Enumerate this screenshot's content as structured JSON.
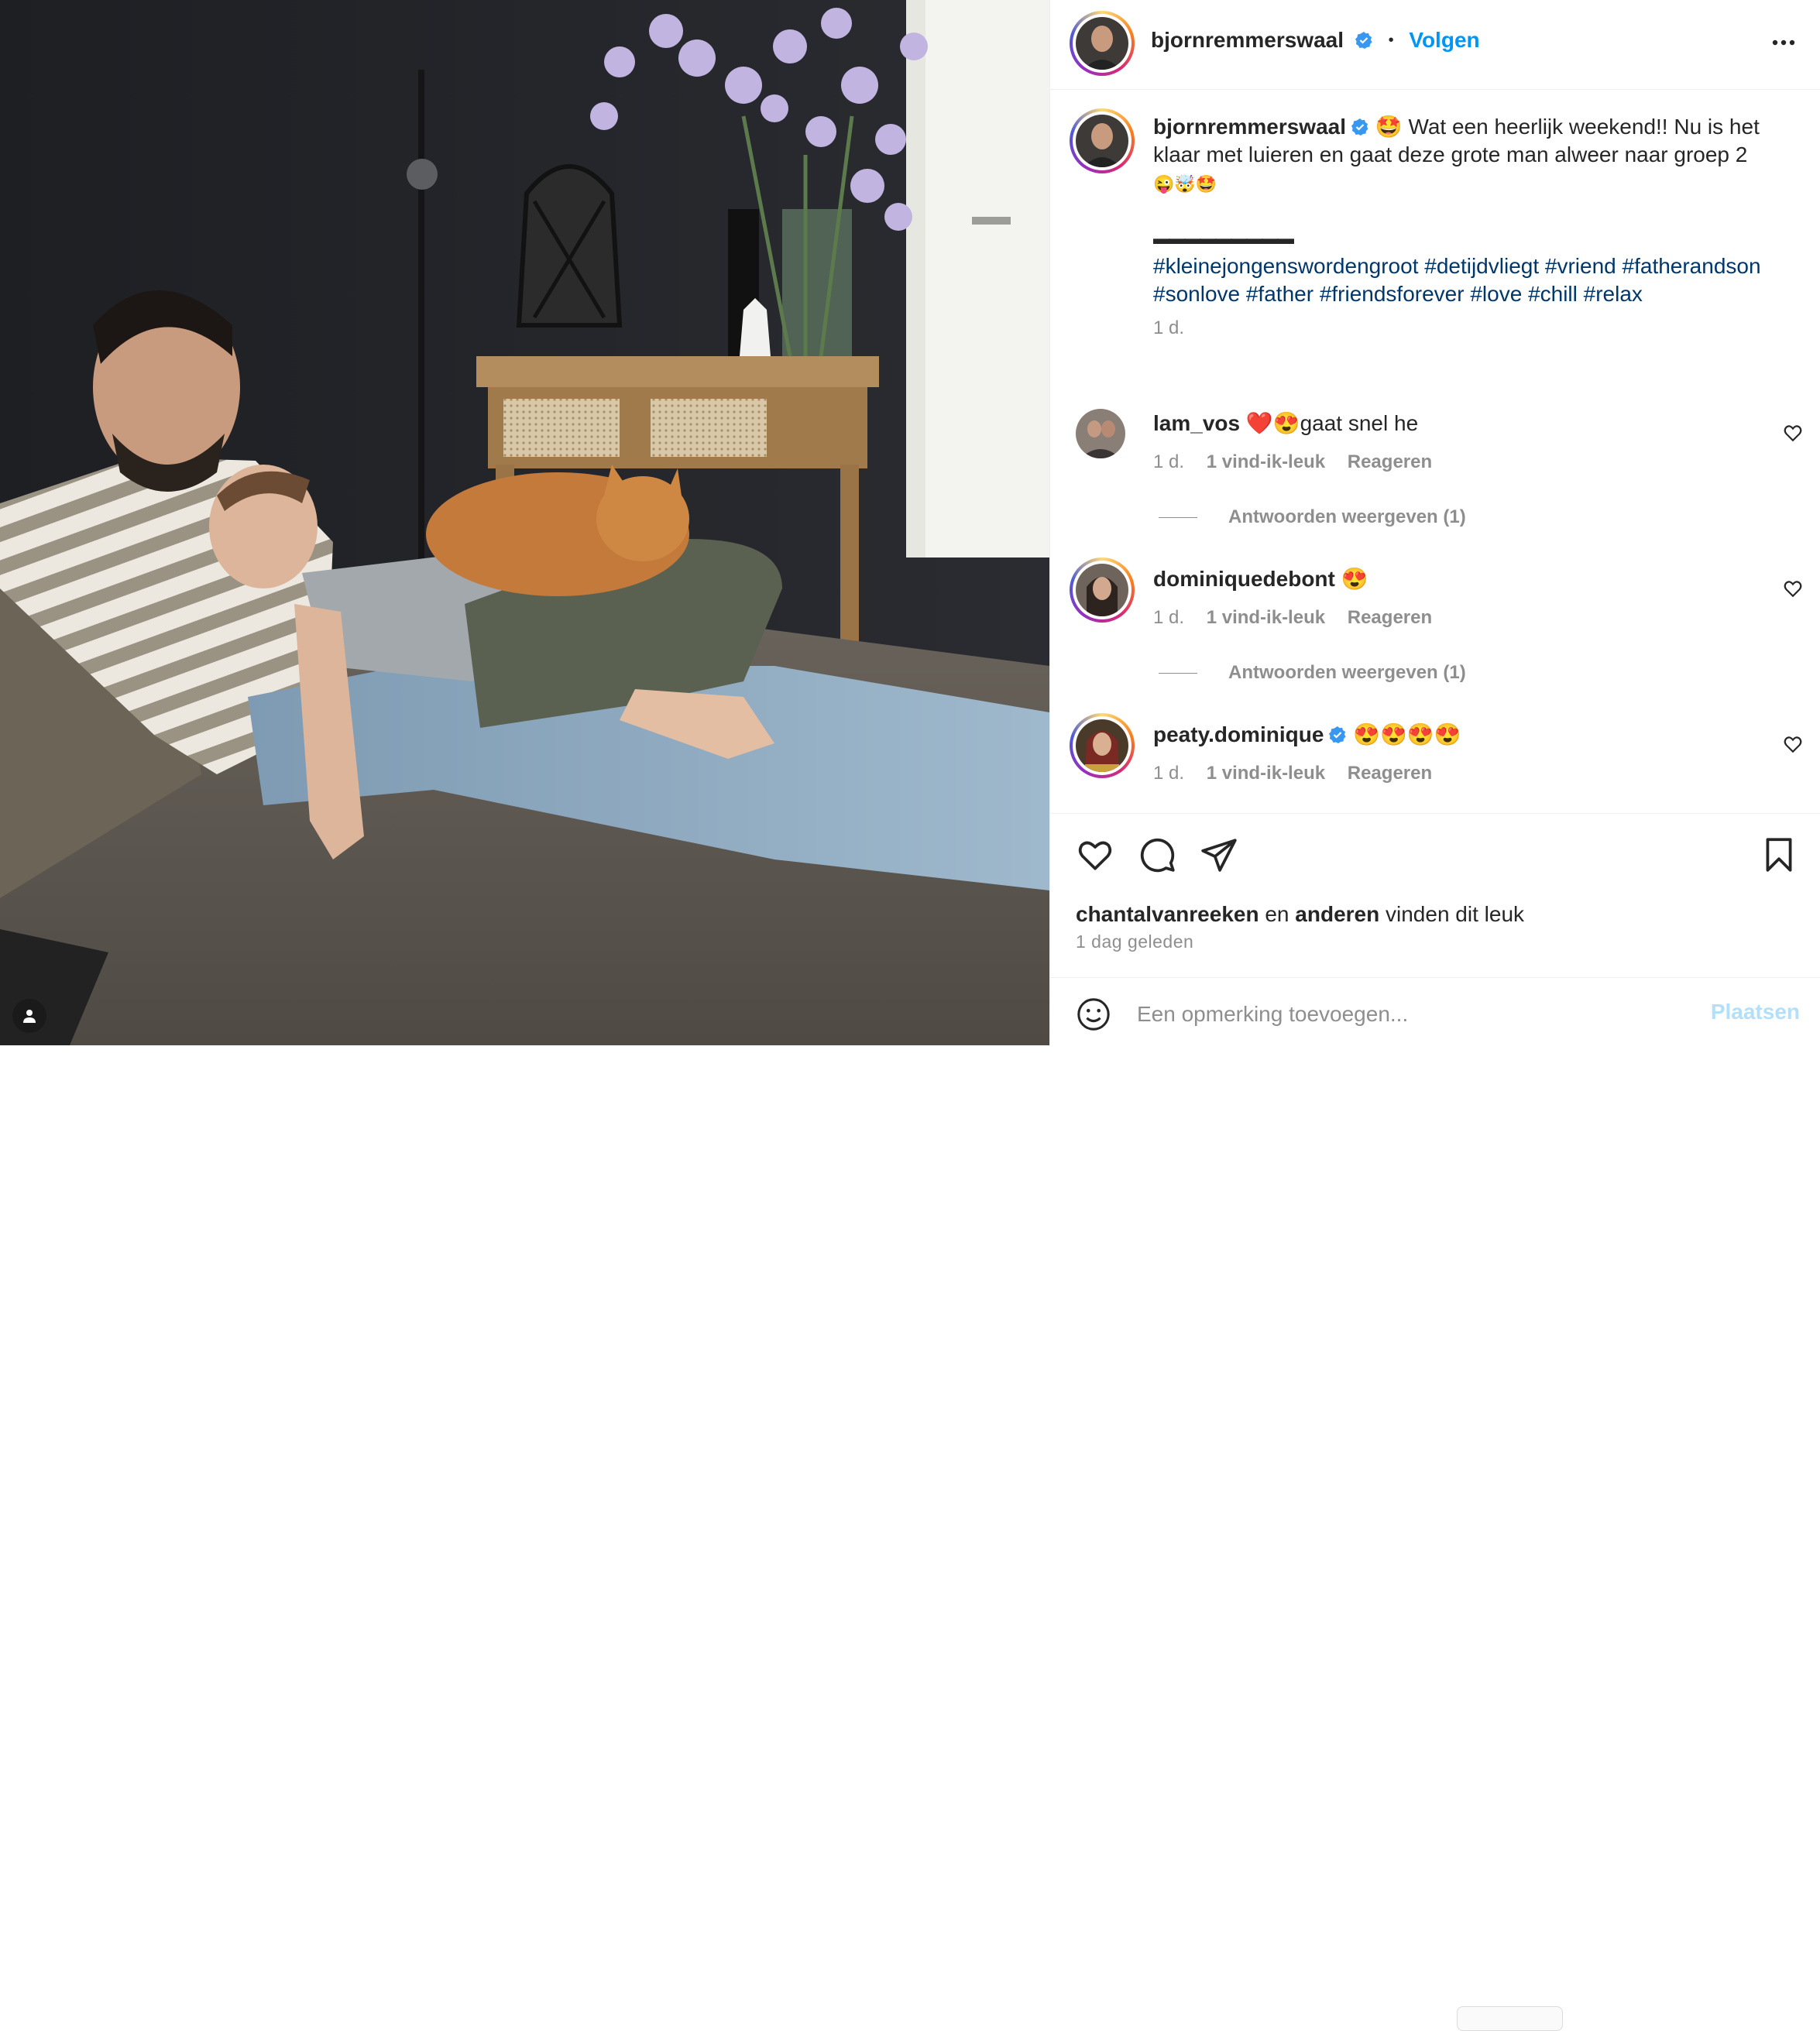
{
  "post": {
    "author": "bjornremmerswaal",
    "follow_label": "Volgen",
    "separator": "•",
    "caption_emoji": "🤩",
    "caption_text": "Wat een heerlijk weekend!! Nu is het klaar met luieren en gaat deze grote man alweer naar groep 2",
    "caption_emoji_line": "😜🤯🤩",
    "caption_dashes": "▬▬▬▬▬▬▬▬▬",
    "hashtags": "#kleinejongenswordengroot #detijdvliegt #vriend #fatherandson #sonlove #father #friendsforever #love #chill #relax",
    "caption_age": "1 d."
  },
  "comments": [
    {
      "user": "lam_vos",
      "text": "❤️😍gaat snel he",
      "age": "1 d.",
      "likes": "1 vind-ik-leuk",
      "reply": "Reageren",
      "view_replies": "Antwoorden weergeven (1)",
      "verified": false
    },
    {
      "user": "dominiquedebont",
      "text": "😍",
      "age": "1 d.",
      "likes": "1 vind-ik-leuk",
      "reply": "Reageren",
      "view_replies": "Antwoorden weergeven (1)",
      "verified": false
    },
    {
      "user": "peaty.dominique",
      "text": "😍😍😍😍",
      "age": "1 d.",
      "likes": "1 vind-ik-leuk",
      "reply": "Reageren",
      "verified": true
    }
  ],
  "likes": {
    "first_user": "chantalvanreeken",
    "and": "en",
    "others": "anderen",
    "suffix": "vinden dit leuk"
  },
  "post_time": "1 dag geleden",
  "comment_box": {
    "placeholder": "Een opmerking toevoegen...",
    "post_label": "Plaatsen"
  },
  "colors": {
    "link_blue": "#0095f6",
    "hashtag_blue": "#00376b",
    "muted": "#8e8e8e",
    "post_disabled": "#b2dffc"
  },
  "icons": [
    "verified-badge-icon",
    "more-options-icon",
    "heart-icon",
    "comment-icon",
    "share-icon",
    "bookmark-icon",
    "emoji-icon",
    "tag-user-icon"
  ]
}
